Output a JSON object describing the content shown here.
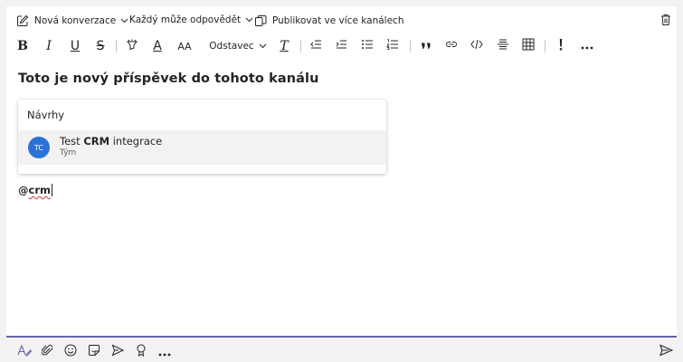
{
  "topbar": {
    "new_conversation": "Nová konverzace",
    "everyone_can_reply": "Každý může odpovědět",
    "publish_multiple": "Publikovat ve více kanálech"
  },
  "format": {
    "bold": "B",
    "italic": "I",
    "underline": "U",
    "strike": "S",
    "font_color": "A",
    "font_size": "AA",
    "paragraph": "Odstavec",
    "clear_format": "T"
  },
  "compose": {
    "subject": "Toto je nový příspěvek do tohoto kanálu",
    "mention_prefix": "@",
    "mention_query": "crm"
  },
  "suggestions": {
    "header": "Návrhy",
    "items": [
      {
        "initials": "TC",
        "name_pre": "Test ",
        "name_match": "CRM",
        "name_post": " integrace",
        "subtitle": "Tým",
        "avatar_color": "#2a72d8"
      }
    ]
  },
  "icons": {
    "top": [
      "compose-icon",
      "chevron-down-icon",
      "copy-icon",
      "trash-icon"
    ],
    "format": [
      "highlight-icon",
      "decrease-indent-icon",
      "increase-indent-icon",
      "bullet-list-icon",
      "numbered-list-icon",
      "quote-icon",
      "link-icon",
      "code-icon",
      "horizontal-rule-icon",
      "table-icon",
      "important-icon",
      "more-icon"
    ],
    "bottom": [
      "format-icon",
      "attach-icon",
      "emoji-icon",
      "sticker-icon",
      "schedule-send-icon",
      "praise-icon",
      "more-icon",
      "send-icon"
    ]
  },
  "colors": {
    "accent": "#6264a7",
    "avatar": "#2a72d8",
    "spell_error": "#d13438"
  }
}
